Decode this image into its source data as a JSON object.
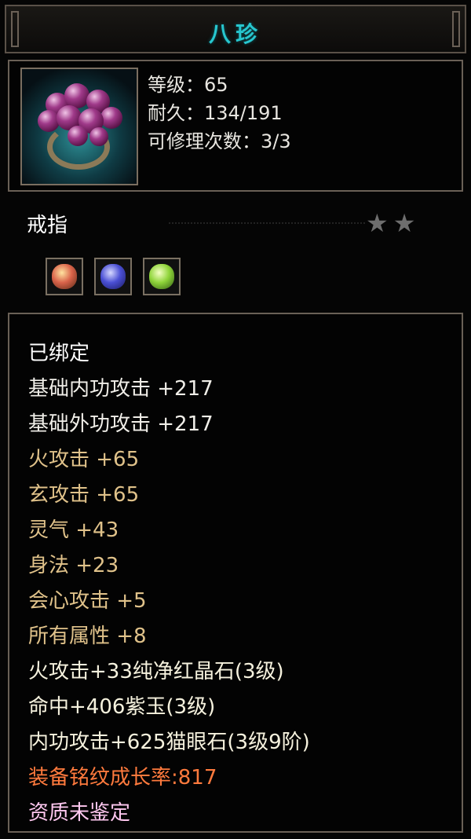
{
  "title": "八珍",
  "colors": {
    "title": "#27c7cf",
    "white_text": "#ffffff",
    "base_attr": "#f0eee8",
    "bonus_attr": "#e0c28a",
    "gem_attr": "#f6f2de",
    "inscription": "#ff7a3d",
    "quality": "#ffc8f0",
    "star": "#6e6e6e"
  },
  "item_icon": "purple-berry-ring-icon",
  "stats": {
    "level": "等级：65",
    "durability": "耐久：134/191",
    "repairs": "可修理次数：3/3"
  },
  "item_type": "戒指",
  "stars": [
    "★",
    "★"
  ],
  "gem_sockets": [
    {
      "icon": "red-gem-icon",
      "color": "#d9634a"
    },
    {
      "icon": "purple-gem-icon",
      "color": "#4a4fd4"
    },
    {
      "icon": "green-gem-icon",
      "color": "#8fd43a"
    }
  ],
  "attributes": [
    {
      "text": "已绑定",
      "kind": "white_text"
    },
    {
      "text": "基础内功攻击  +217",
      "kind": "base_attr"
    },
    {
      "text": "基础外功攻击  +217",
      "kind": "base_attr"
    },
    {
      "text": "火攻击  +65",
      "kind": "bonus_attr"
    },
    {
      "text": "玄攻击  +65",
      "kind": "bonus_attr"
    },
    {
      "text": "灵气  +43",
      "kind": "bonus_attr"
    },
    {
      "text": "身法  +23",
      "kind": "bonus_attr"
    },
    {
      "text": "会心攻击  +5",
      "kind": "bonus_attr"
    },
    {
      "text": "所有属性  +8",
      "kind": "bonus_attr"
    },
    {
      "text": "火攻击+33纯净红晶石(3级)",
      "kind": "gem_attr"
    },
    {
      "text": "命中+406紫玉(3级)",
      "kind": "gem_attr"
    },
    {
      "text": "内功攻击+625猫眼石(3级9阶)",
      "kind": "gem_attr"
    },
    {
      "text": "装备铭纹成长率:817",
      "kind": "inscription"
    },
    {
      "text": "资质未鉴定",
      "kind": "quality"
    }
  ]
}
